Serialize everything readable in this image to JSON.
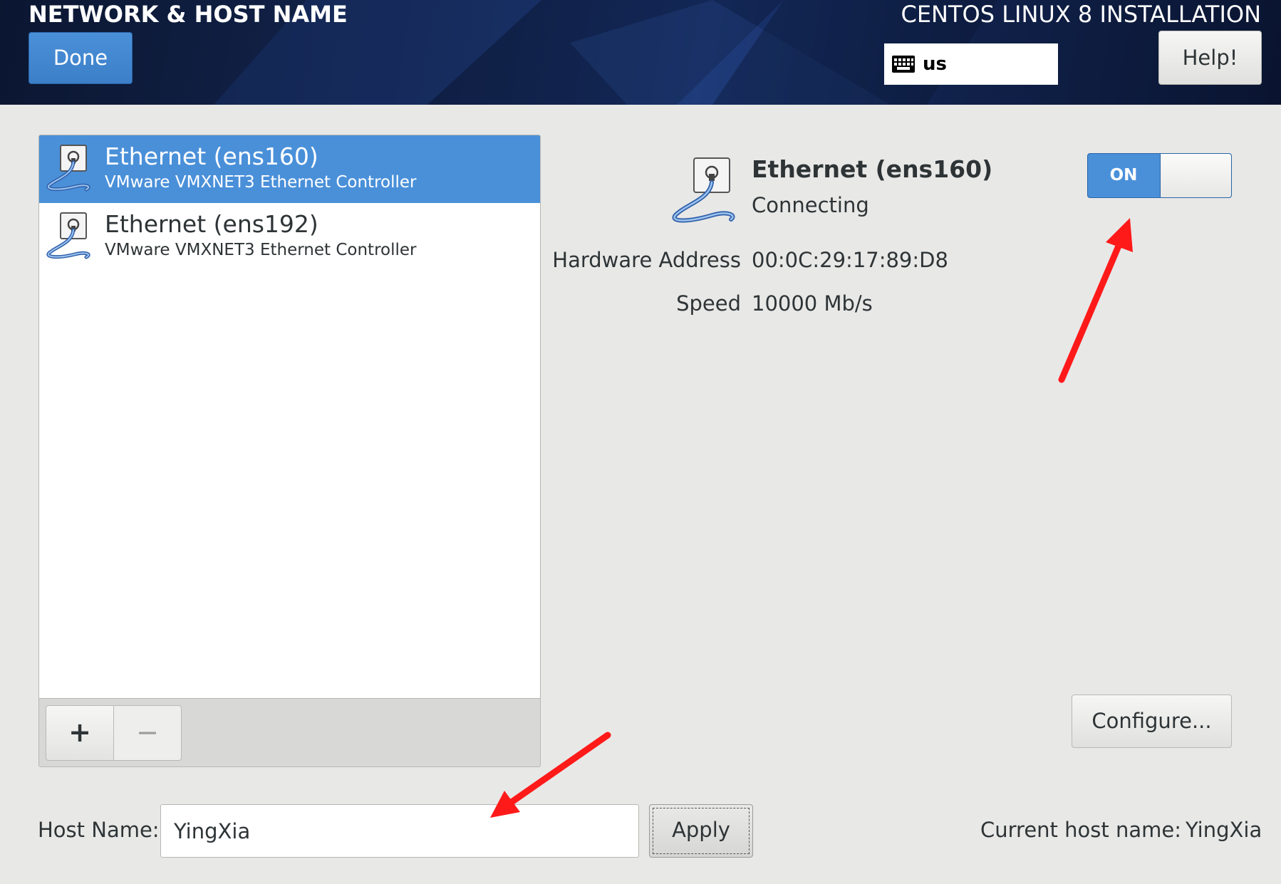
{
  "header": {
    "spoke_title": "NETWORK & HOST NAME",
    "product_title": "CENTOS LINUX 8 INSTALLATION",
    "done_label": "Done",
    "help_label": "Help!",
    "keyboard_layout": "us",
    "keyboard_icon": "keyboard-icon"
  },
  "devices": [
    {
      "name": "Ethernet (ens160)",
      "description": "VMware VMXNET3 Ethernet Controller",
      "selected": true,
      "icon": "ethernet-cable-icon"
    },
    {
      "name": "Ethernet (ens192)",
      "description": "VMware VMXNET3 Ethernet Controller",
      "selected": false,
      "icon": "ethernet-cable-icon"
    }
  ],
  "list_toolbar": {
    "add_label": "+",
    "remove_label": "−"
  },
  "detail": {
    "name": "Ethernet (ens160)",
    "status": "Connecting",
    "hardware_address_label": "Hardware Address",
    "hardware_address": "00:0C:29:17:89:D8",
    "speed_label": "Speed",
    "speed": "10000 Mb/s",
    "switch_label": "ON",
    "switch_state": true,
    "configure_label": "Configure..."
  },
  "hostname": {
    "label": "Host Name:",
    "value": "YingXia",
    "apply_label": "Apply",
    "current_label": "Current host name:",
    "current_value": "YingXia"
  },
  "colors": {
    "accent": "#4a90d9",
    "header_bg": "#13254f",
    "annotation_arrow": "#ff1a1a"
  }
}
